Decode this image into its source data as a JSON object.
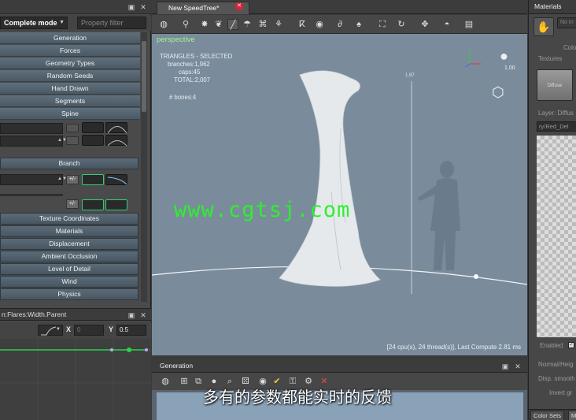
{
  "left_panel": {
    "mode": "Complete mode",
    "filter_placeholder": "Property filter",
    "menu_items": [
      "Generation",
      "Forces",
      "Geometry Types",
      "Random Seeds",
      "Hand Drawn",
      "Segments",
      "Spine"
    ],
    "branch_label": "Branch",
    "plus_minus": "+/-",
    "sections": [
      "Texture Coordinates",
      "Materials",
      "Displacement",
      "Ambient Occlusion",
      "Level of Detail",
      "Wind",
      "Physics"
    ],
    "curve_path": "n:Flares:Width.Parent",
    "x_label": "X",
    "x_value": "0",
    "y_label": "Y",
    "y_value": "0.5"
  },
  "viewport": {
    "tab_title": "New SpeedTree*",
    "camera_label": "perspective",
    "stats": {
      "heading": "TRIANGLES - SELECTED",
      "branches": "branches:1,962",
      "caps": "caps:45",
      "total": "TOTAL:2,007",
      "bones": "# bones:4"
    },
    "zoom": "1.00",
    "height_label": "1.87",
    "compute": "[24 cpu(s), 24 thread(s)], Last Compute 2.81 ms",
    "watermark": "www.cgtsj.com",
    "bg_color": "#7a8c9c"
  },
  "generation_panel": {
    "title": "Generation"
  },
  "subtitle": "多有的参数都能实时的反馈",
  "right_panel": {
    "title": "Materials",
    "no_material": "No m",
    "color_label": "Colo",
    "textures_label": "Textures",
    "diffuse": "Diffuse",
    "layer_label": "Layer: Diffus",
    "path": "ry/Red_Del",
    "enabled": "Enabled",
    "normal_height": "Normal/Heig",
    "disp_smooth": "Disp. smooth",
    "invert": "Invert gr",
    "tabs": [
      "Color Sets",
      "M"
    ]
  }
}
